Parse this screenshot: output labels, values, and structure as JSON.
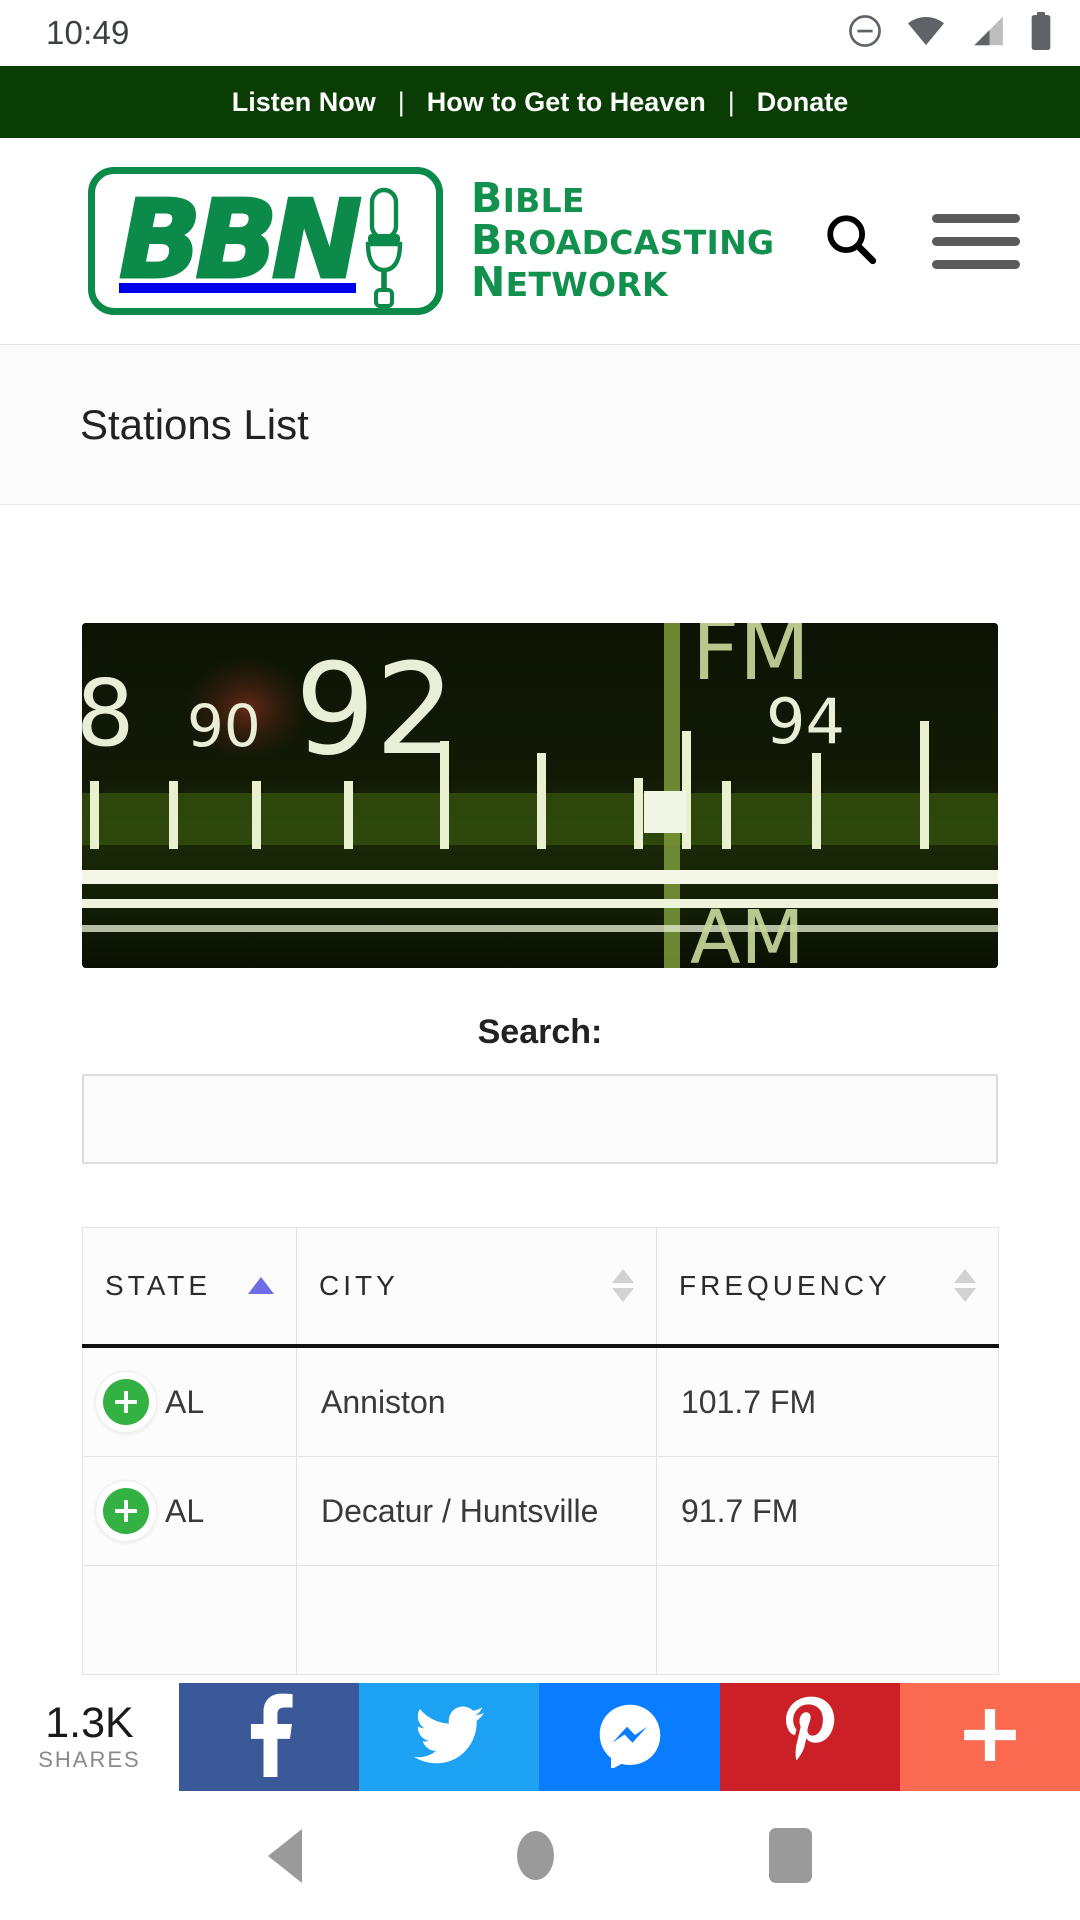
{
  "status_bar": {
    "time": "10:49",
    "icons": [
      "do-not-disturb-icon",
      "wifi-icon",
      "cellular-signal-icon",
      "battery-icon"
    ]
  },
  "top_nav": {
    "items": [
      {
        "label": "Listen Now"
      },
      {
        "label": "How to Get to Heaven"
      },
      {
        "label": "Donate"
      }
    ],
    "separator": "|",
    "background": "#093d04",
    "text_color": "#ffffff"
  },
  "header": {
    "logo_text": "BBN",
    "brand_lines": [
      {
        "cap": "B",
        "rest": "IBLE"
      },
      {
        "cap": "B",
        "rest": "ROADCASTING"
      },
      {
        "cap": "N",
        "rest": "ETWORK"
      }
    ],
    "brand_color": "#12904e",
    "search_icon": "search-icon",
    "menu_icon": "hamburger-menu-icon"
  },
  "page": {
    "title": "Stations List"
  },
  "hero": {
    "alt": "vintage radio tuning dial",
    "dial_labels": [
      "90",
      "92",
      "94"
    ],
    "band_labels": [
      "FM",
      "AM"
    ]
  },
  "search": {
    "label": "Search:",
    "value": "",
    "placeholder": ""
  },
  "table": {
    "columns": [
      {
        "key": "state",
        "label": "STATE",
        "sort": "asc"
      },
      {
        "key": "city",
        "label": "CITY",
        "sort": "none"
      },
      {
        "key": "frequency",
        "label": "FREQUENCY",
        "sort": "none"
      }
    ],
    "rows": [
      {
        "expand": "+",
        "state": "AL",
        "city": "Anniston",
        "frequency": "101.7 FM"
      },
      {
        "expand": "+",
        "state": "AL",
        "city": "Decatur / Huntsville",
        "frequency": "91.7 FM"
      }
    ]
  },
  "share_bar": {
    "count": "1.3K",
    "count_label": "SHARES",
    "buttons": [
      {
        "name": "facebook",
        "color": "#3b5998"
      },
      {
        "name": "twitter",
        "color": "#1da1f2"
      },
      {
        "name": "messenger",
        "color": "#0a7cff"
      },
      {
        "name": "pinterest",
        "color": "#cb2027"
      },
      {
        "name": "more",
        "color": "#fa6a51"
      }
    ]
  },
  "android_nav": {
    "back": "back-button",
    "home": "home-button",
    "recents": "recents-button"
  }
}
